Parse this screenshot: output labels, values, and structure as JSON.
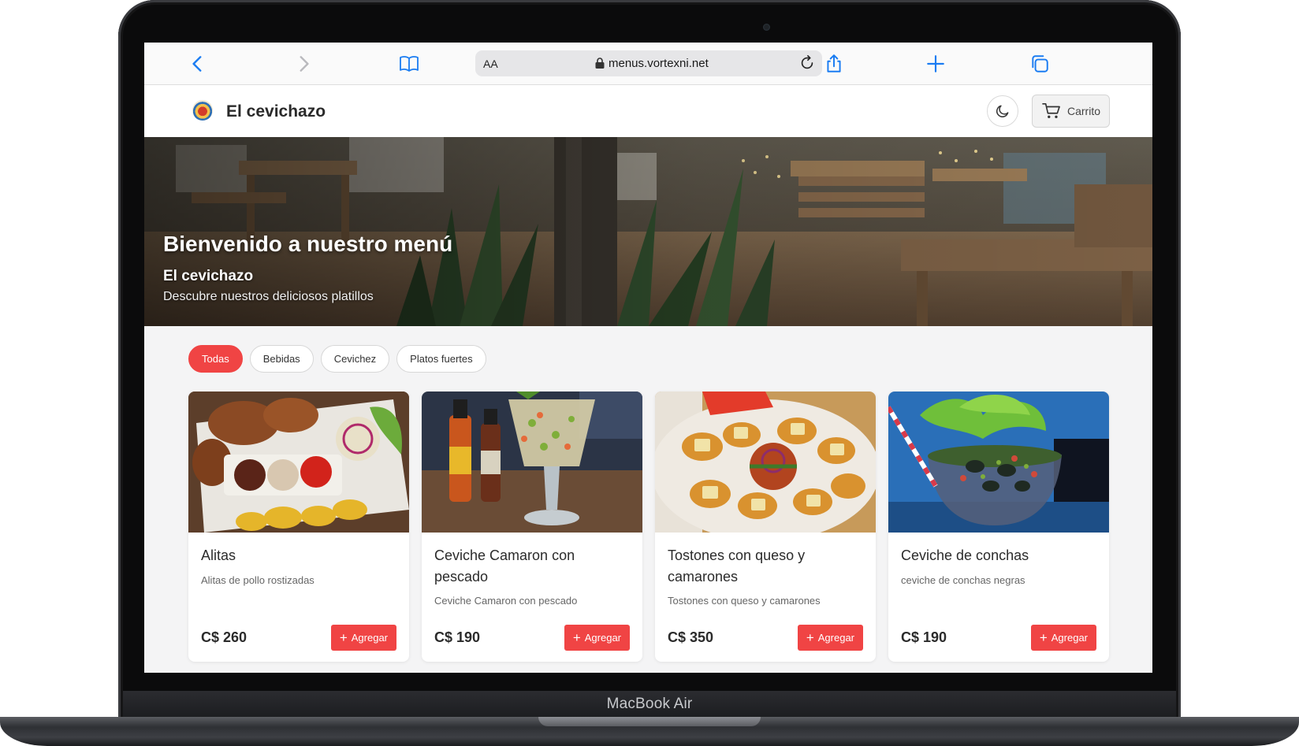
{
  "device": {
    "label": "MacBook Air"
  },
  "browser": {
    "text_size_label": "AA",
    "url": "menus.vortexni.net",
    "icons": [
      "back-icon",
      "forward-icon",
      "bookmarks-icon",
      "lock-icon",
      "reload-icon",
      "share-icon",
      "new-tab-icon",
      "tabs-icon"
    ]
  },
  "header": {
    "brand": "El cevichazo",
    "cart_label": "Carrito",
    "theme_icon": "moon-icon",
    "cart_icon": "cart-icon"
  },
  "hero": {
    "title": "Bienvenido a nuestro menú",
    "restaurant_name": "El cevichazo",
    "subtitle": "Descubre nuestros deliciosos platillos"
  },
  "filters": [
    {
      "label": "Todas",
      "active": true
    },
    {
      "label": "Bebidas",
      "active": false
    },
    {
      "label": "Cevichez",
      "active": false
    },
    {
      "label": "Platos fuertes",
      "active": false
    }
  ],
  "products": [
    {
      "title": "Alitas",
      "description": "Alitas de pollo rostizadas",
      "price": "C$ 260",
      "button": "Agregar"
    },
    {
      "title": "Ceviche Camaron con pescado",
      "description": "Ceviche Camaron con pescado",
      "price": "C$ 190",
      "button": "Agregar"
    },
    {
      "title": "Tostones con queso y camarones",
      "description": "Tostones con queso y camarones",
      "price": "C$ 350",
      "button": "Agregar"
    },
    {
      "title": "Ceviche de conchas",
      "description": "ceviche de conchas negras",
      "price": "C$ 190",
      "button": "Agregar"
    }
  ],
  "colors": {
    "accent": "#f04444",
    "safari_blue": "#1a7cf2"
  }
}
